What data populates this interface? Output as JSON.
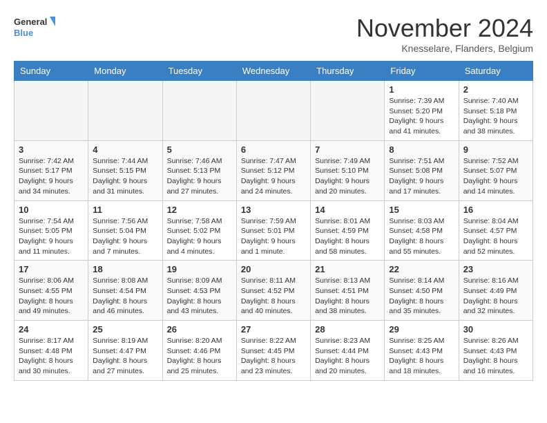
{
  "logo": {
    "line1": "General",
    "line2": "Blue"
  },
  "title": "November 2024",
  "location": "Knesselare, Flanders, Belgium",
  "headers": [
    "Sunday",
    "Monday",
    "Tuesday",
    "Wednesday",
    "Thursday",
    "Friday",
    "Saturday"
  ],
  "weeks": [
    [
      {
        "day": "",
        "info": ""
      },
      {
        "day": "",
        "info": ""
      },
      {
        "day": "",
        "info": ""
      },
      {
        "day": "",
        "info": ""
      },
      {
        "day": "",
        "info": ""
      },
      {
        "day": "1",
        "info": "Sunrise: 7:39 AM\nSunset: 5:20 PM\nDaylight: 9 hours\nand 41 minutes."
      },
      {
        "day": "2",
        "info": "Sunrise: 7:40 AM\nSunset: 5:18 PM\nDaylight: 9 hours\nand 38 minutes."
      }
    ],
    [
      {
        "day": "3",
        "info": "Sunrise: 7:42 AM\nSunset: 5:17 PM\nDaylight: 9 hours\nand 34 minutes."
      },
      {
        "day": "4",
        "info": "Sunrise: 7:44 AM\nSunset: 5:15 PM\nDaylight: 9 hours\nand 31 minutes."
      },
      {
        "day": "5",
        "info": "Sunrise: 7:46 AM\nSunset: 5:13 PM\nDaylight: 9 hours\nand 27 minutes."
      },
      {
        "day": "6",
        "info": "Sunrise: 7:47 AM\nSunset: 5:12 PM\nDaylight: 9 hours\nand 24 minutes."
      },
      {
        "day": "7",
        "info": "Sunrise: 7:49 AM\nSunset: 5:10 PM\nDaylight: 9 hours\nand 20 minutes."
      },
      {
        "day": "8",
        "info": "Sunrise: 7:51 AM\nSunset: 5:08 PM\nDaylight: 9 hours\nand 17 minutes."
      },
      {
        "day": "9",
        "info": "Sunrise: 7:52 AM\nSunset: 5:07 PM\nDaylight: 9 hours\nand 14 minutes."
      }
    ],
    [
      {
        "day": "10",
        "info": "Sunrise: 7:54 AM\nSunset: 5:05 PM\nDaylight: 9 hours\nand 11 minutes."
      },
      {
        "day": "11",
        "info": "Sunrise: 7:56 AM\nSunset: 5:04 PM\nDaylight: 9 hours\nand 7 minutes."
      },
      {
        "day": "12",
        "info": "Sunrise: 7:58 AM\nSunset: 5:02 PM\nDaylight: 9 hours\nand 4 minutes."
      },
      {
        "day": "13",
        "info": "Sunrise: 7:59 AM\nSunset: 5:01 PM\nDaylight: 9 hours\nand 1 minute."
      },
      {
        "day": "14",
        "info": "Sunrise: 8:01 AM\nSunset: 4:59 PM\nDaylight: 8 hours\nand 58 minutes."
      },
      {
        "day": "15",
        "info": "Sunrise: 8:03 AM\nSunset: 4:58 PM\nDaylight: 8 hours\nand 55 minutes."
      },
      {
        "day": "16",
        "info": "Sunrise: 8:04 AM\nSunset: 4:57 PM\nDaylight: 8 hours\nand 52 minutes."
      }
    ],
    [
      {
        "day": "17",
        "info": "Sunrise: 8:06 AM\nSunset: 4:55 PM\nDaylight: 8 hours\nand 49 minutes."
      },
      {
        "day": "18",
        "info": "Sunrise: 8:08 AM\nSunset: 4:54 PM\nDaylight: 8 hours\nand 46 minutes."
      },
      {
        "day": "19",
        "info": "Sunrise: 8:09 AM\nSunset: 4:53 PM\nDaylight: 8 hours\nand 43 minutes."
      },
      {
        "day": "20",
        "info": "Sunrise: 8:11 AM\nSunset: 4:52 PM\nDaylight: 8 hours\nand 40 minutes."
      },
      {
        "day": "21",
        "info": "Sunrise: 8:13 AM\nSunset: 4:51 PM\nDaylight: 8 hours\nand 38 minutes."
      },
      {
        "day": "22",
        "info": "Sunrise: 8:14 AM\nSunset: 4:50 PM\nDaylight: 8 hours\nand 35 minutes."
      },
      {
        "day": "23",
        "info": "Sunrise: 8:16 AM\nSunset: 4:49 PM\nDaylight: 8 hours\nand 32 minutes."
      }
    ],
    [
      {
        "day": "24",
        "info": "Sunrise: 8:17 AM\nSunset: 4:48 PM\nDaylight: 8 hours\nand 30 minutes."
      },
      {
        "day": "25",
        "info": "Sunrise: 8:19 AM\nSunset: 4:47 PM\nDaylight: 8 hours\nand 27 minutes."
      },
      {
        "day": "26",
        "info": "Sunrise: 8:20 AM\nSunset: 4:46 PM\nDaylight: 8 hours\nand 25 minutes."
      },
      {
        "day": "27",
        "info": "Sunrise: 8:22 AM\nSunset: 4:45 PM\nDaylight: 8 hours\nand 23 minutes."
      },
      {
        "day": "28",
        "info": "Sunrise: 8:23 AM\nSunset: 4:44 PM\nDaylight: 8 hours\nand 20 minutes."
      },
      {
        "day": "29",
        "info": "Sunrise: 8:25 AM\nSunset: 4:43 PM\nDaylight: 8 hours\nand 18 minutes."
      },
      {
        "day": "30",
        "info": "Sunrise: 8:26 AM\nSunset: 4:43 PM\nDaylight: 8 hours\nand 16 minutes."
      }
    ]
  ]
}
